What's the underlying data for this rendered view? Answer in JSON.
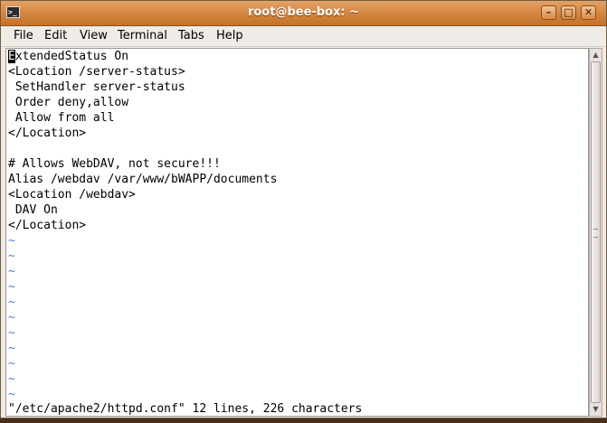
{
  "window": {
    "title": "root@bee-box: ~"
  },
  "menu": {
    "file": "File",
    "edit": "Edit",
    "view": "View",
    "terminal": "Terminal",
    "tabs": "Tabs",
    "help": "Help"
  },
  "editor": {
    "cursor_char": "E",
    "lines": [
      "xtendedStatus On",
      "<Location /server-status>",
      " SetHandler server-status",
      " Order deny,allow",
      " Allow from all",
      "</Location>",
      "",
      "# Allows WebDAV, not secure!!!",
      "Alias /webdav /var/www/bWAPP/documents",
      "<Location /webdav>",
      " DAV On",
      "</Location>"
    ],
    "tilde": "~",
    "status": "\"/etc/apache2/httpd.conf\" 12 lines, 226 characters"
  }
}
